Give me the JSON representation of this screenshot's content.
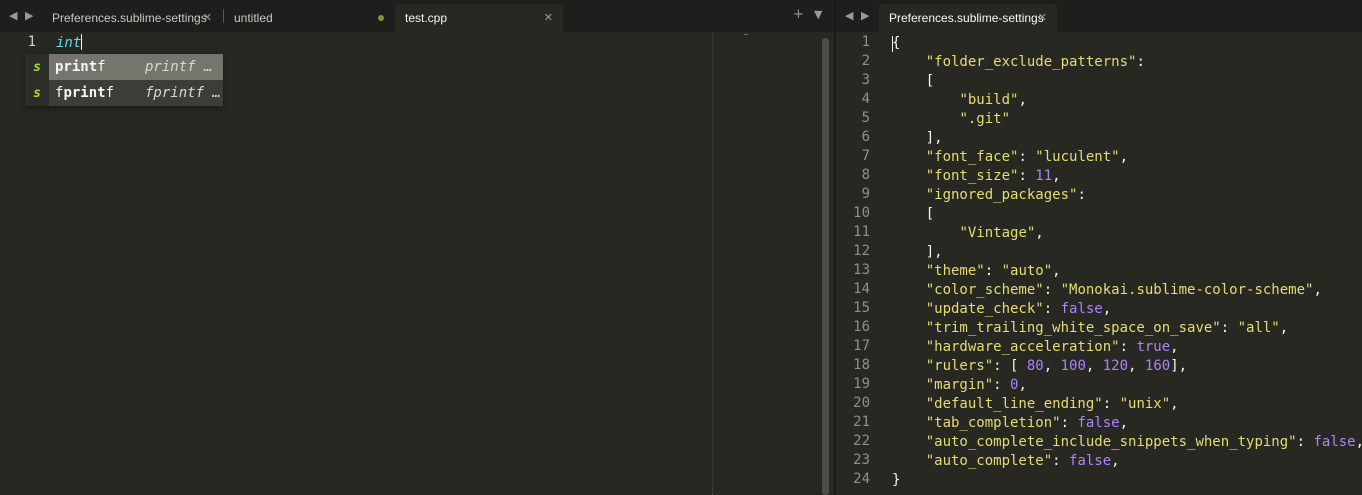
{
  "left_pane": {
    "tabs": [
      {
        "label": "Preferences.sublime-settings",
        "state": "close"
      },
      {
        "label": "untitled",
        "state": "dirty"
      },
      {
        "label": "test.cpp",
        "state": "active"
      }
    ],
    "nav_left": "◀",
    "nav_right": "▶",
    "new_tab": "+",
    "tab_menu": "▼",
    "close_glyph": "✕",
    "editor": {
      "line_number": "1",
      "typed_text": "int"
    },
    "autocomplete": [
      {
        "kind": "s",
        "trigger_match": "print",
        "trigger_pre": "",
        "trigger_post": "f",
        "detail": "printf …",
        "selected": true
      },
      {
        "kind": "s",
        "trigger_match": "print",
        "trigger_pre": "f",
        "trigger_post": "f",
        "detail": "fprintf …",
        "selected": false
      }
    ]
  },
  "right_pane": {
    "tabs": [
      {
        "label": "Preferences.sublime-settings",
        "state": "active"
      }
    ],
    "nav_left": "◀",
    "nav_right": "▶",
    "close_glyph": "✕",
    "line_numbers": [
      "1",
      "2",
      "3",
      "4",
      "5",
      "6",
      "7",
      "8",
      "9",
      "10",
      "11",
      "12",
      "13",
      "14",
      "15",
      "16",
      "17",
      "18",
      "19",
      "20",
      "21",
      "22",
      "23",
      "24"
    ],
    "code_lines": [
      "{",
      "    \"folder_exclude_patterns\":",
      "    [",
      "        \"build\",",
      "        \".git\"",
      "    ],",
      "    \"font_face\": \"luculent\",",
      "    \"font_size\": 11,",
      "    \"ignored_packages\":",
      "    [",
      "        \"Vintage\",",
      "    ],",
      "    \"theme\": \"auto\",",
      "    \"color_scheme\": \"Monokai.sublime-color-scheme\",",
      "    \"update_check\": false,",
      "    \"trim_trailing_white_space_on_save\": \"all\",",
      "    \"hardware_acceleration\": true,",
      "    \"rulers\": [ 80, 100, 120, 160],",
      "    \"margin\": 0,",
      "    \"default_line_ending\": \"unix\",",
      "    \"tab_completion\": false,",
      "    \"auto_complete_include_snippets_when_typing\": false,",
      "    \"auto_complete\": false,",
      "}"
    ]
  },
  "colors": {
    "background": "#272822",
    "tabbar": "#1e1f1c",
    "string": "#e6db74",
    "constant": "#ae81ff",
    "keyword_italic": "#66d9ef",
    "snippet_kind": "#a6e22e",
    "dirty_dot": "#7a9a3a"
  }
}
